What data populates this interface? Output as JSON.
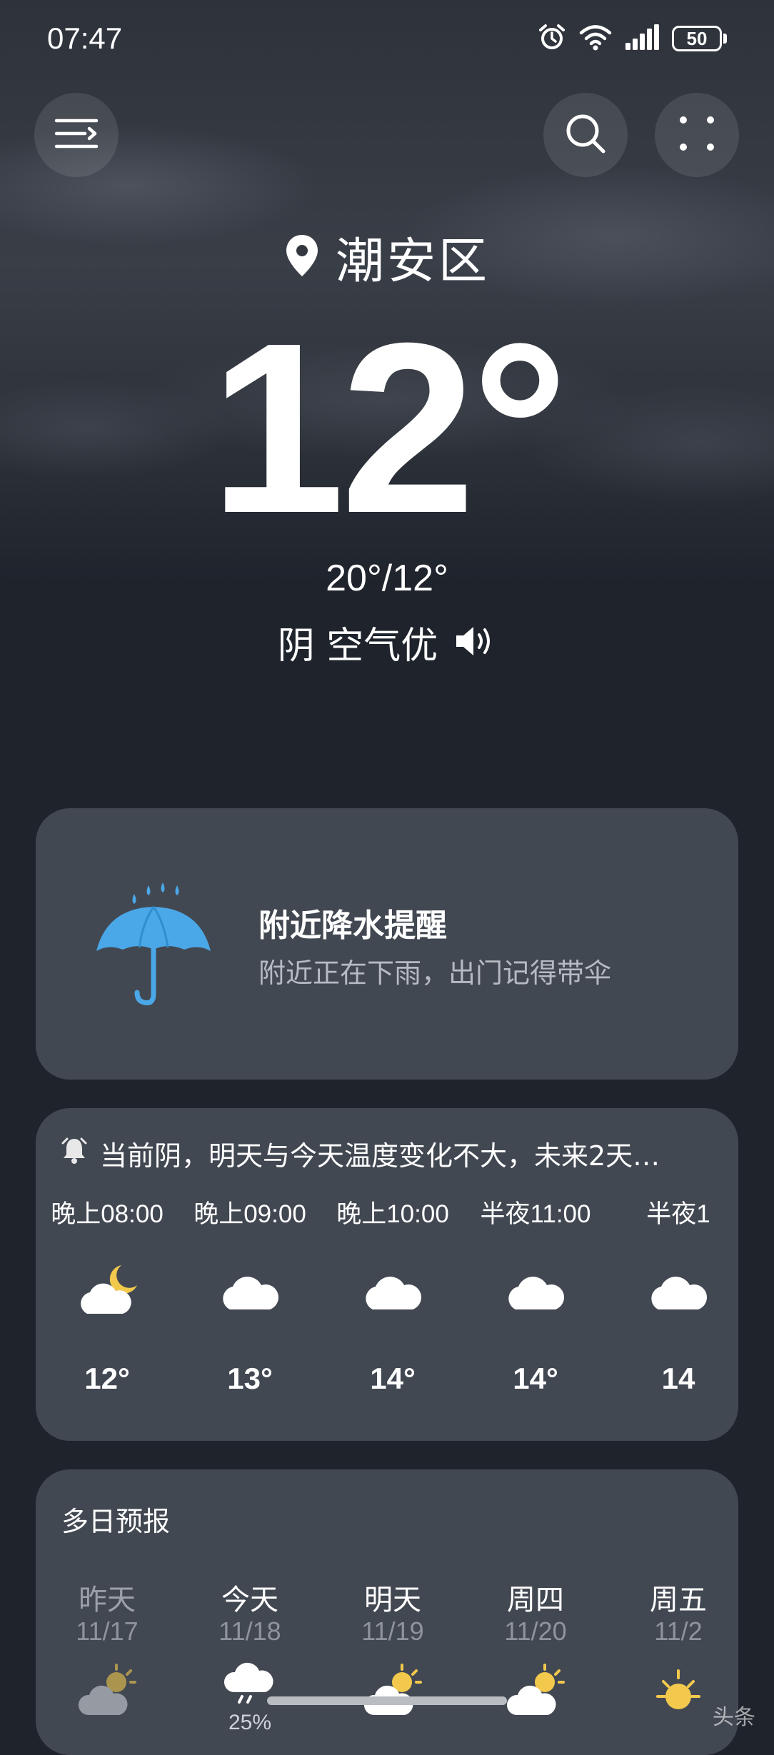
{
  "status_bar": {
    "time": "07:47",
    "battery": "50",
    "icons": [
      "alarm-icon",
      "wifi-icon",
      "signal-icon",
      "battery-icon"
    ]
  },
  "header": {
    "menu_icon": "menu-icon",
    "search_icon": "search-icon",
    "more_icon": "more-dots-icon"
  },
  "location": {
    "name": "潮安区",
    "icon": "location-pin-icon"
  },
  "current": {
    "temp": "12°",
    "hilo": "20°/12°",
    "condition": "阴 空气优",
    "speaker_icon": "speaker-icon"
  },
  "alert": {
    "icon": "umbrella-rain-icon",
    "title": "附近降水提醒",
    "body": "附近正在下雨，出门记得带伞"
  },
  "hourly": {
    "summary": "当前阴，明天与今天温度变化不大，未来2天…",
    "summary_icon": "bell-icon",
    "items": [
      {
        "label": "晚上08:00",
        "temp": "12°",
        "icon": "moon-cloud-icon"
      },
      {
        "label": "晚上09:00",
        "temp": "13°",
        "icon": "cloud-icon"
      },
      {
        "label": "晚上10:00",
        "temp": "14°",
        "icon": "cloud-icon"
      },
      {
        "label": "半夜11:00",
        "temp": "14°",
        "icon": "cloud-icon"
      },
      {
        "label": "半夜1",
        "temp": "14",
        "icon": "cloud-icon"
      }
    ]
  },
  "daily": {
    "title": "多日预报",
    "items": [
      {
        "name": "昨天",
        "date": "11/17",
        "icon": "sun-cloud-icon",
        "precip": ""
      },
      {
        "name": "今天",
        "date": "11/18",
        "icon": "cloud-rain-icon",
        "precip": "25%"
      },
      {
        "name": "明天",
        "date": "11/19",
        "icon": "sun-cloud-icon",
        "precip": ""
      },
      {
        "name": "周四",
        "date": "11/20",
        "icon": "sun-cloud-icon",
        "precip": ""
      },
      {
        "name": "周五",
        "date": "11/2",
        "icon": "sun-icon",
        "precip": ""
      }
    ]
  },
  "watermark": "头条"
}
